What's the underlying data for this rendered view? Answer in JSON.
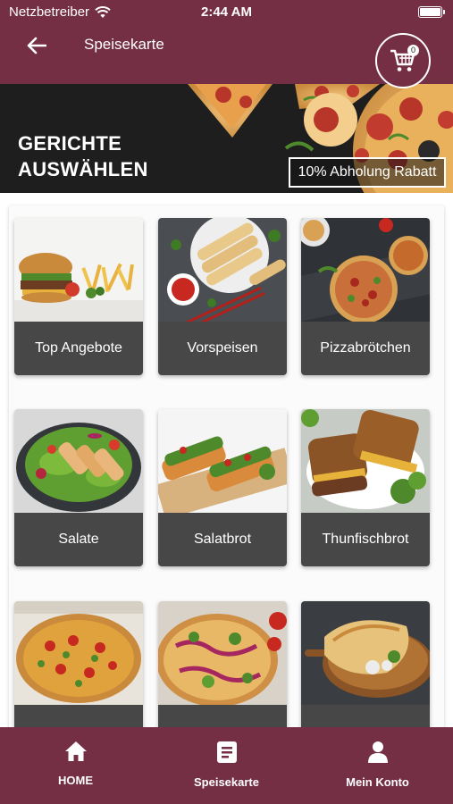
{
  "status_bar": {
    "carrier": "Netzbetreiber",
    "time": "2:44 AM"
  },
  "header": {
    "title": "Speisekarte",
    "back_icon": "arrow-left-icon",
    "cart_icon": "cart-icon",
    "cart_count": "0"
  },
  "banner": {
    "title_line1": "GERICHTE",
    "title_line2": "AUSWÄHLEN",
    "promo": "10% Abholung Rabatt"
  },
  "categories": [
    {
      "label": "Top Angebote"
    },
    {
      "label": "Vorspeisen"
    },
    {
      "label": "Pizzabrötchen"
    },
    {
      "label": "Salate"
    },
    {
      "label": "Salatbrot"
    },
    {
      "label": "Thunfischbrot"
    },
    {
      "label": ""
    },
    {
      "label": ""
    },
    {
      "label": ""
    }
  ],
  "bottom_nav": [
    {
      "label": "HOME",
      "icon": "home-icon"
    },
    {
      "label": "Speisekarte",
      "icon": "menu-book-icon"
    },
    {
      "label": "Mein Konto",
      "icon": "user-icon"
    }
  ],
  "colors": {
    "brand": "#742f45",
    "card_label_bg": "#474747",
    "banner_bg": "#1e1e1f"
  }
}
